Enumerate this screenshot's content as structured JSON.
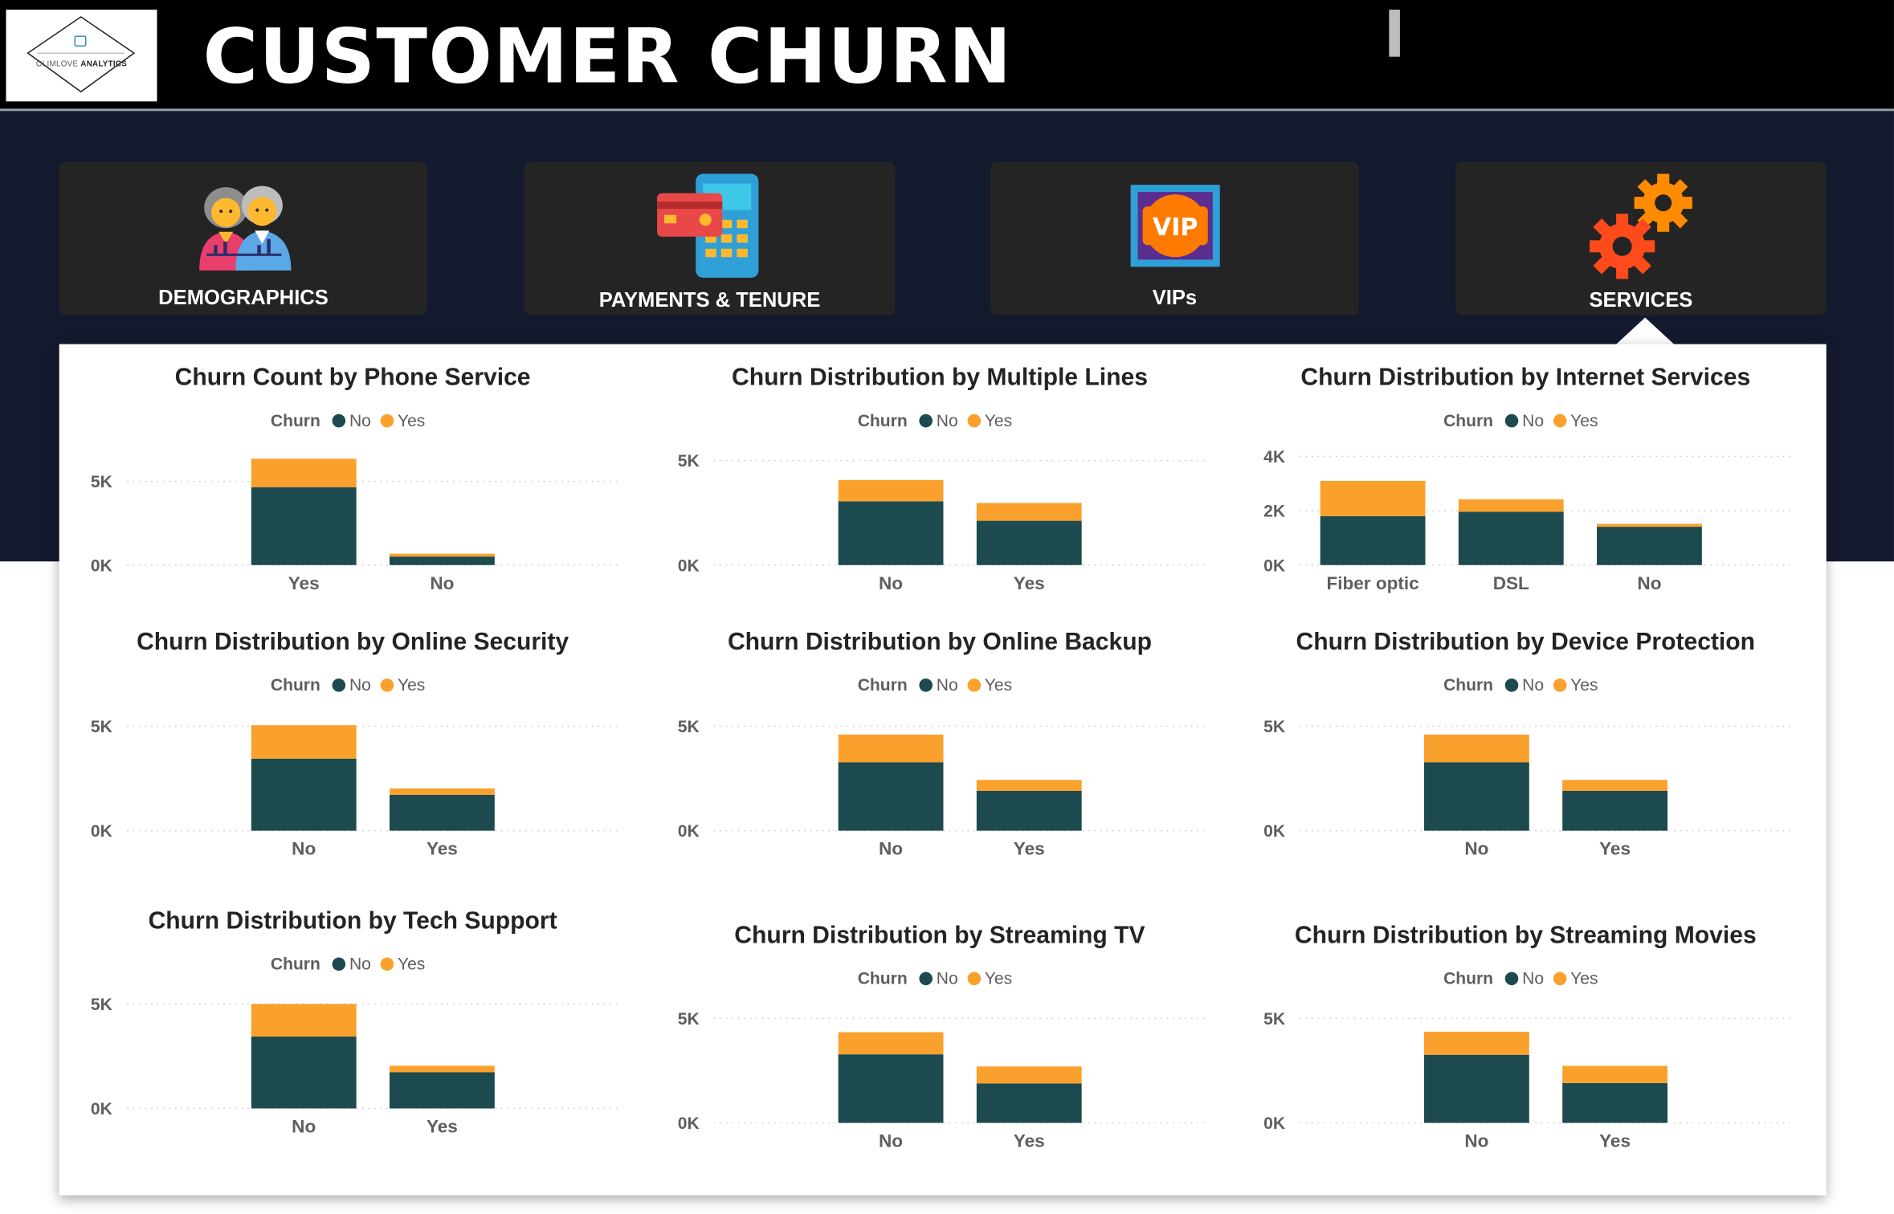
{
  "header": {
    "title": "CUSTOMER CHURN",
    "logo_text_light": "OLIMLOVE",
    "logo_text_bold": "ANALYTICS"
  },
  "nav": {
    "tiles": [
      {
        "label": "DEMOGRAPHICS",
        "icon": "family-icon"
      },
      {
        "label": "PAYMENTS & TENURE",
        "icon": "payment-terminal-icon"
      },
      {
        "label": "VIPs",
        "icon": "vip-icon"
      },
      {
        "label": "SERVICES",
        "icon": "gears-icon"
      }
    ],
    "active": "SERVICES"
  },
  "colors": {
    "no": "#1d4a4e",
    "yes": "#faa12d",
    "header_bg": "#000000",
    "navy_bg": "#141a2e",
    "tile_bg": "#252424"
  },
  "legend": {
    "title": "Churn",
    "no": "No",
    "yes": "Yes"
  },
  "chart_data": [
    {
      "type": "bar",
      "stacked": true,
      "title": "Churn Count by Phone Service",
      "categories": [
        "Yes",
        "No"
      ],
      "yticks": [
        "0K",
        "5K"
      ],
      "ylim": [
        0,
        6500
      ],
      "series": [
        {
          "name": "No",
          "values": [
            4660,
            510
          ]
        },
        {
          "name": "Yes",
          "values": [
            1700,
            170
          ]
        }
      ]
    },
    {
      "type": "bar",
      "stacked": true,
      "title": "Churn Distribution by Multiple Lines",
      "categories": [
        "No",
        "Yes"
      ],
      "yticks": [
        "0K",
        "5K"
      ],
      "ylim": [
        0,
        5200
      ],
      "series": [
        {
          "name": "No",
          "values": [
            3050,
            2120
          ]
        },
        {
          "name": "Yes",
          "values": [
            1020,
            850
          ]
        }
      ]
    },
    {
      "type": "bar",
      "stacked": true,
      "title": "Churn Distribution by Internet Services",
      "categories": [
        "Fiber optic",
        "DSL",
        "No"
      ],
      "yticks": [
        "0K",
        "2K",
        "4K"
      ],
      "ylim": [
        0,
        4000
      ],
      "series": [
        {
          "name": "No",
          "values": [
            1800,
            1960,
            1410
          ]
        },
        {
          "name": "Yes",
          "values": [
            1300,
            460,
            110
          ]
        }
      ]
    },
    {
      "type": "bar",
      "stacked": true,
      "title": "Churn Distribution by Online Security",
      "categories": [
        "No",
        "Yes"
      ],
      "yticks": [
        "0K",
        "5K"
      ],
      "ylim": [
        0,
        5200
      ],
      "series": [
        {
          "name": "No",
          "values": [
            3450,
            1720
          ]
        },
        {
          "name": "Yes",
          "values": [
            1600,
            300
          ]
        }
      ]
    },
    {
      "type": "bar",
      "stacked": true,
      "title": "Churn Distribution by Online Backup",
      "categories": [
        "No",
        "Yes"
      ],
      "yticks": [
        "0K",
        "5K"
      ],
      "ylim": [
        0,
        5200
      ],
      "series": [
        {
          "name": "No",
          "values": [
            3270,
            1910
          ]
        },
        {
          "name": "Yes",
          "values": [
            1330,
            520
          ]
        }
      ]
    },
    {
      "type": "bar",
      "stacked": true,
      "title": "Churn Distribution by Device Protection",
      "categories": [
        "No",
        "Yes"
      ],
      "yticks": [
        "0K",
        "5K"
      ],
      "ylim": [
        0,
        5200
      ],
      "series": [
        {
          "name": "No",
          "values": [
            3270,
            1910
          ]
        },
        {
          "name": "Yes",
          "values": [
            1330,
            520
          ]
        }
      ]
    },
    {
      "type": "bar",
      "stacked": true,
      "title": "Churn Distribution by Tech Support",
      "categories": [
        "No",
        "Yes"
      ],
      "yticks": [
        "0K",
        "5K"
      ],
      "ylim": [
        0,
        5200
      ],
      "series": [
        {
          "name": "No",
          "values": [
            3440,
            1730
          ]
        },
        {
          "name": "Yes",
          "values": [
            1560,
            310
          ]
        }
      ]
    },
    {
      "type": "bar",
      "stacked": true,
      "title": "Churn Distribution by Streaming TV",
      "categories": [
        "No",
        "Yes"
      ],
      "yticks": [
        "0K",
        "5K"
      ],
      "ylim": [
        0,
        5200
      ],
      "series": [
        {
          "name": "No",
          "values": [
            3280,
            1890
          ]
        },
        {
          "name": "Yes",
          "values": [
            1060,
            810
          ]
        }
      ]
    },
    {
      "type": "bar",
      "stacked": true,
      "title": "Churn Distribution by Streaming Movies",
      "categories": [
        "No",
        "Yes"
      ],
      "yticks": [
        "0K",
        "5K"
      ],
      "ylim": [
        0,
        5200
      ],
      "series": [
        {
          "name": "No",
          "values": [
            3260,
            1910
          ]
        },
        {
          "name": "Yes",
          "values": [
            1100,
            820
          ]
        }
      ]
    }
  ]
}
